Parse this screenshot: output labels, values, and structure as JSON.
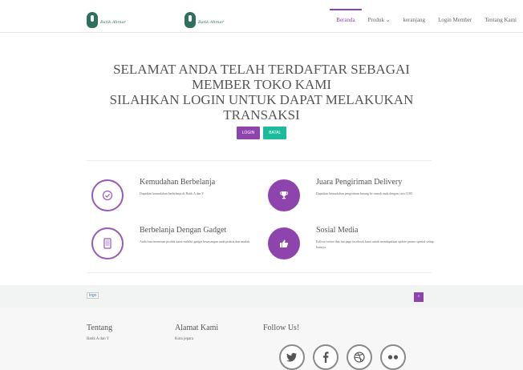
{
  "nav": {
    "logo_text": "Batik Ahmar",
    "items": [
      {
        "label": "Beranda"
      },
      {
        "label": "Produk ⌄"
      },
      {
        "label": "keranjang"
      },
      {
        "label": "Login Member"
      },
      {
        "label": "Tentang Kami"
      }
    ],
    "active_color": "#8e44ad"
  },
  "main": {
    "headline_1": "SELAMAT ANDA TELAH TERDAFTAR SEBAGAI MEMBER TOKO KAMI",
    "headline_2": "SILAHKAN LOGIN UNTUK DAPAT MELAKUKAN TRANSAKSI",
    "login_label": "LOGIN",
    "batal_label": "BATAL"
  },
  "features": [
    {
      "title": "Kemudahan Berbelanja",
      "desc": "Dapatkan kemudahan berbelanja di Batik A dan Y",
      "icon": "check-icon"
    },
    {
      "title": "Juara Pengiriman Delivery",
      "desc": "Dapatkan kemudahan pengiriman barang ke rumah anda dengan cara COD",
      "icon": "trophy-icon"
    },
    {
      "title": "Berbelanja Dengan Gadget",
      "desc": "Anda bisa memesan produk kami melalui gadget kesayangan anda praktis dan mudah.",
      "icon": "mobile-icon"
    },
    {
      "title": "Sosial Media",
      "desc": "Follow twitter dan fan page facebook kami untuk mendapatkan update promo spesial setiap harinya.",
      "icon": "thumbs-up-icon"
    }
  ],
  "footer": {
    "logo_alt": "logo",
    "tentang_heading": "Tentang",
    "tentang_text": "Batik A dan Y",
    "alamat_heading": "Alamat Kami",
    "alamat_text": "Kota jepara",
    "follow_heading": "Follow Us!",
    "social": [
      "twitter-icon",
      "facebook-icon",
      "dribbble-icon",
      "flickr-icon"
    ]
  },
  "colors": {
    "accent": "#8e44ad",
    "secondary": "#1abc9c"
  }
}
